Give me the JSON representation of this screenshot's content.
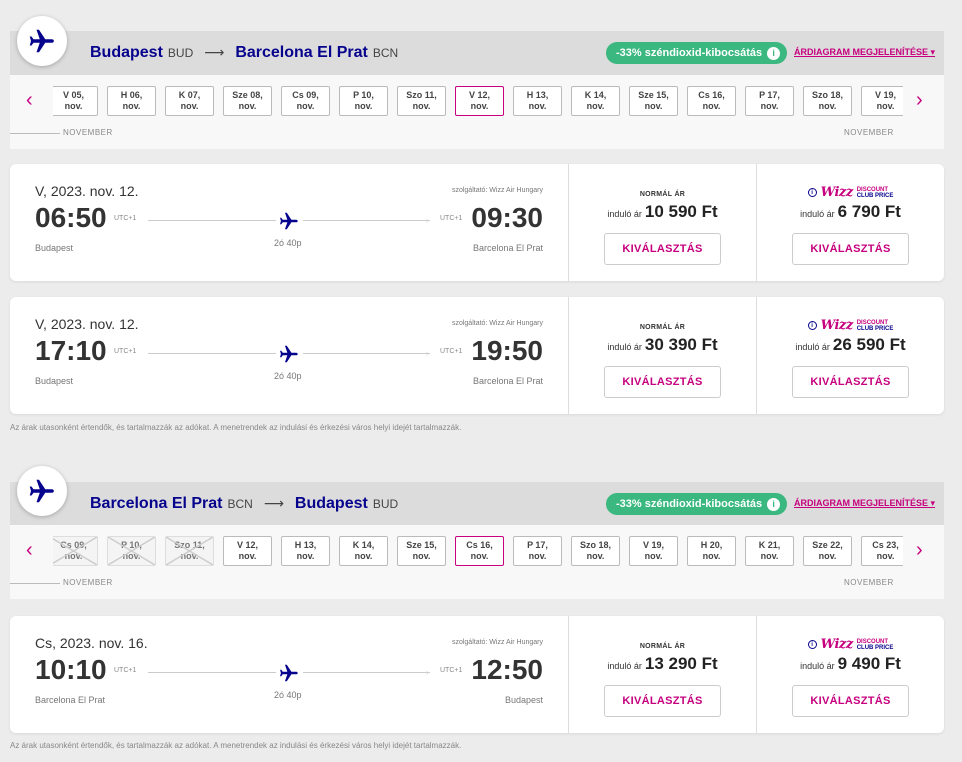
{
  "colors": {
    "brand_magenta": "#c6007e",
    "brand_navy": "#06038d",
    "eco_green": "#3ab880"
  },
  "outbound": {
    "header": {
      "origin_city": "Budapest",
      "origin_code": "BUD",
      "arrow": "⟶",
      "dest_city": "Barcelona El Prat",
      "dest_code": "BCN",
      "co2_text": "-33% széndioxid-kibocsátás",
      "price_chart_link": "ÁRDIAGRAM MEGJELENÍTÉSE"
    },
    "dates": [
      {
        "l1": "V 05,",
        "l2": "nov."
      },
      {
        "l1": "H 06,",
        "l2": "nov."
      },
      {
        "l1": "K 07,",
        "l2": "nov."
      },
      {
        "l1": "Sze 08,",
        "l2": "nov."
      },
      {
        "l1": "Cs 09,",
        "l2": "nov."
      },
      {
        "l1": "P 10,",
        "l2": "nov."
      },
      {
        "l1": "Szo 11,",
        "l2": "nov."
      },
      {
        "l1": "V 12,",
        "l2": "nov."
      },
      {
        "l1": "H 13,",
        "l2": "nov."
      },
      {
        "l1": "K 14,",
        "l2": "nov."
      },
      {
        "l1": "Sze 15,",
        "l2": "nov."
      },
      {
        "l1": "Cs 16,",
        "l2": "nov."
      },
      {
        "l1": "P 17,",
        "l2": "nov."
      },
      {
        "l1": "Szo 18,",
        "l2": "nov."
      },
      {
        "l1": "V 19,",
        "l2": "nov."
      }
    ],
    "month_left": "NOVEMBER",
    "month_right": "NOVEMBER",
    "flights": [
      {
        "date": "V, 2023. nov. 12.",
        "operator": "szolgáltató: Wizz Air Hungary",
        "dep_time": "06:50",
        "arr_time": "09:30",
        "dep_utc": "UTC+1",
        "arr_utc": "UTC+1",
        "duration": "2ó 40p",
        "dep_city": "Budapest",
        "arr_city": "Barcelona El Prat",
        "normal_label": "NORMÁL ÁR",
        "from_label": "induló ár",
        "normal_price": "10 590 Ft",
        "club_label_1": "DISCOUNT",
        "club_label_2": "CLUB PRICE",
        "club_wizz": "Wizz",
        "club_price": "6 790 Ft",
        "select_label": "KIVÁLASZTÁS"
      },
      {
        "date": "V, 2023. nov. 12.",
        "operator": "szolgáltató: Wizz Air Hungary",
        "dep_time": "17:10",
        "arr_time": "19:50",
        "dep_utc": "UTC+1",
        "arr_utc": "UTC+1",
        "duration": "2ó 40p",
        "dep_city": "Budapest",
        "arr_city": "Barcelona El Prat",
        "normal_label": "NORMÁL ÁR",
        "from_label": "induló ár",
        "normal_price": "30 390 Ft",
        "club_label_1": "DISCOUNT",
        "club_label_2": "CLUB PRICE",
        "club_wizz": "Wizz",
        "club_price": "26 590 Ft",
        "select_label": "KIVÁLASZTÁS"
      }
    ],
    "disclaimer": "Az árak utasonként értendők, és tartalmazzák az adókat. A menetrendek az indulási és érkezési város helyi idejét tartalmazzák."
  },
  "inbound": {
    "header": {
      "origin_city": "Barcelona El Prat",
      "origin_code": "BCN",
      "arrow": "⟶",
      "dest_city": "Budapest",
      "dest_code": "BUD",
      "co2_text": "-33% széndioxid-kibocsátás",
      "price_chart_link": "ÁRDIAGRAM MEGJELENÍTÉSE"
    },
    "dates": [
      {
        "l1": "Cs 09,",
        "l2": "nov."
      },
      {
        "l1": "P 10,",
        "l2": "nov."
      },
      {
        "l1": "Szo 11,",
        "l2": "nov."
      },
      {
        "l1": "V 12,",
        "l2": "nov."
      },
      {
        "l1": "H 13,",
        "l2": "nov."
      },
      {
        "l1": "K 14,",
        "l2": "nov."
      },
      {
        "l1": "Sze 15,",
        "l2": "nov."
      },
      {
        "l1": "Cs 16,",
        "l2": "nov."
      },
      {
        "l1": "P 17,",
        "l2": "nov."
      },
      {
        "l1": "Szo 18,",
        "l2": "nov."
      },
      {
        "l1": "V 19,",
        "l2": "nov."
      },
      {
        "l1": "H 20,",
        "l2": "nov."
      },
      {
        "l1": "K 21,",
        "l2": "nov."
      },
      {
        "l1": "Sze 22,",
        "l2": "nov."
      },
      {
        "l1": "Cs 23,",
        "l2": "nov."
      }
    ],
    "month_left": "NOVEMBER",
    "month_right": "NOVEMBER",
    "flights": [
      {
        "date": "Cs, 2023. nov. 16.",
        "operator": "szolgáltató: Wizz Air Hungary",
        "dep_time": "10:10",
        "arr_time": "12:50",
        "dep_utc": "UTC+1",
        "arr_utc": "UTC+1",
        "duration": "2ó 40p",
        "dep_city": "Barcelona El Prat",
        "arr_city": "Budapest",
        "normal_label": "NORMÁL ÁR",
        "from_label": "induló ár",
        "normal_price": "13 290 Ft",
        "club_label_1": "DISCOUNT",
        "club_label_2": "CLUB PRICE",
        "club_wizz": "Wizz",
        "club_price": "9 490 Ft",
        "select_label": "KIVÁLASZTÁS"
      }
    ],
    "disclaimer": "Az árak utasonként értendők, és tartalmazzák az adókat. A menetrendek az indulási és érkezési város helyi idejét tartalmazzák."
  },
  "arrows": {
    "prev": "‹",
    "next": "›"
  },
  "info_glyph": "i"
}
